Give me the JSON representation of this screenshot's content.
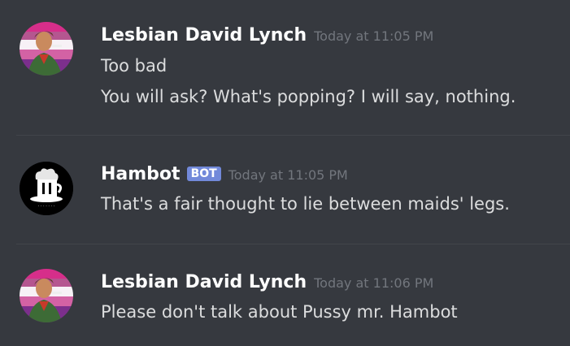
{
  "messages": [
    {
      "author": "Lesbian David Lynch",
      "timestamp": "Today at 11:05 PM",
      "lines": [
        "Too bad",
        "You will ask? What's popping? I will say, nothing."
      ]
    },
    {
      "author": "Hambot",
      "badge": "BOT",
      "timestamp": "Today at 11:05 PM",
      "lines": [
        "That's a fair thought to lie between maids' legs."
      ]
    },
    {
      "author": "Lesbian David Lynch",
      "timestamp": "Today at 11:06 PM",
      "lines": [
        "Please don't talk about Pussy mr. Hambot"
      ]
    }
  ],
  "colors": {
    "background": "#36393f",
    "username": "#ffffff",
    "timestamp": "#72767d",
    "text": "#dcddde",
    "bot_badge": "#7289da",
    "avatar_flag_top": "#d62e8a",
    "avatar_flag_bottom": "#7c2f8c"
  }
}
